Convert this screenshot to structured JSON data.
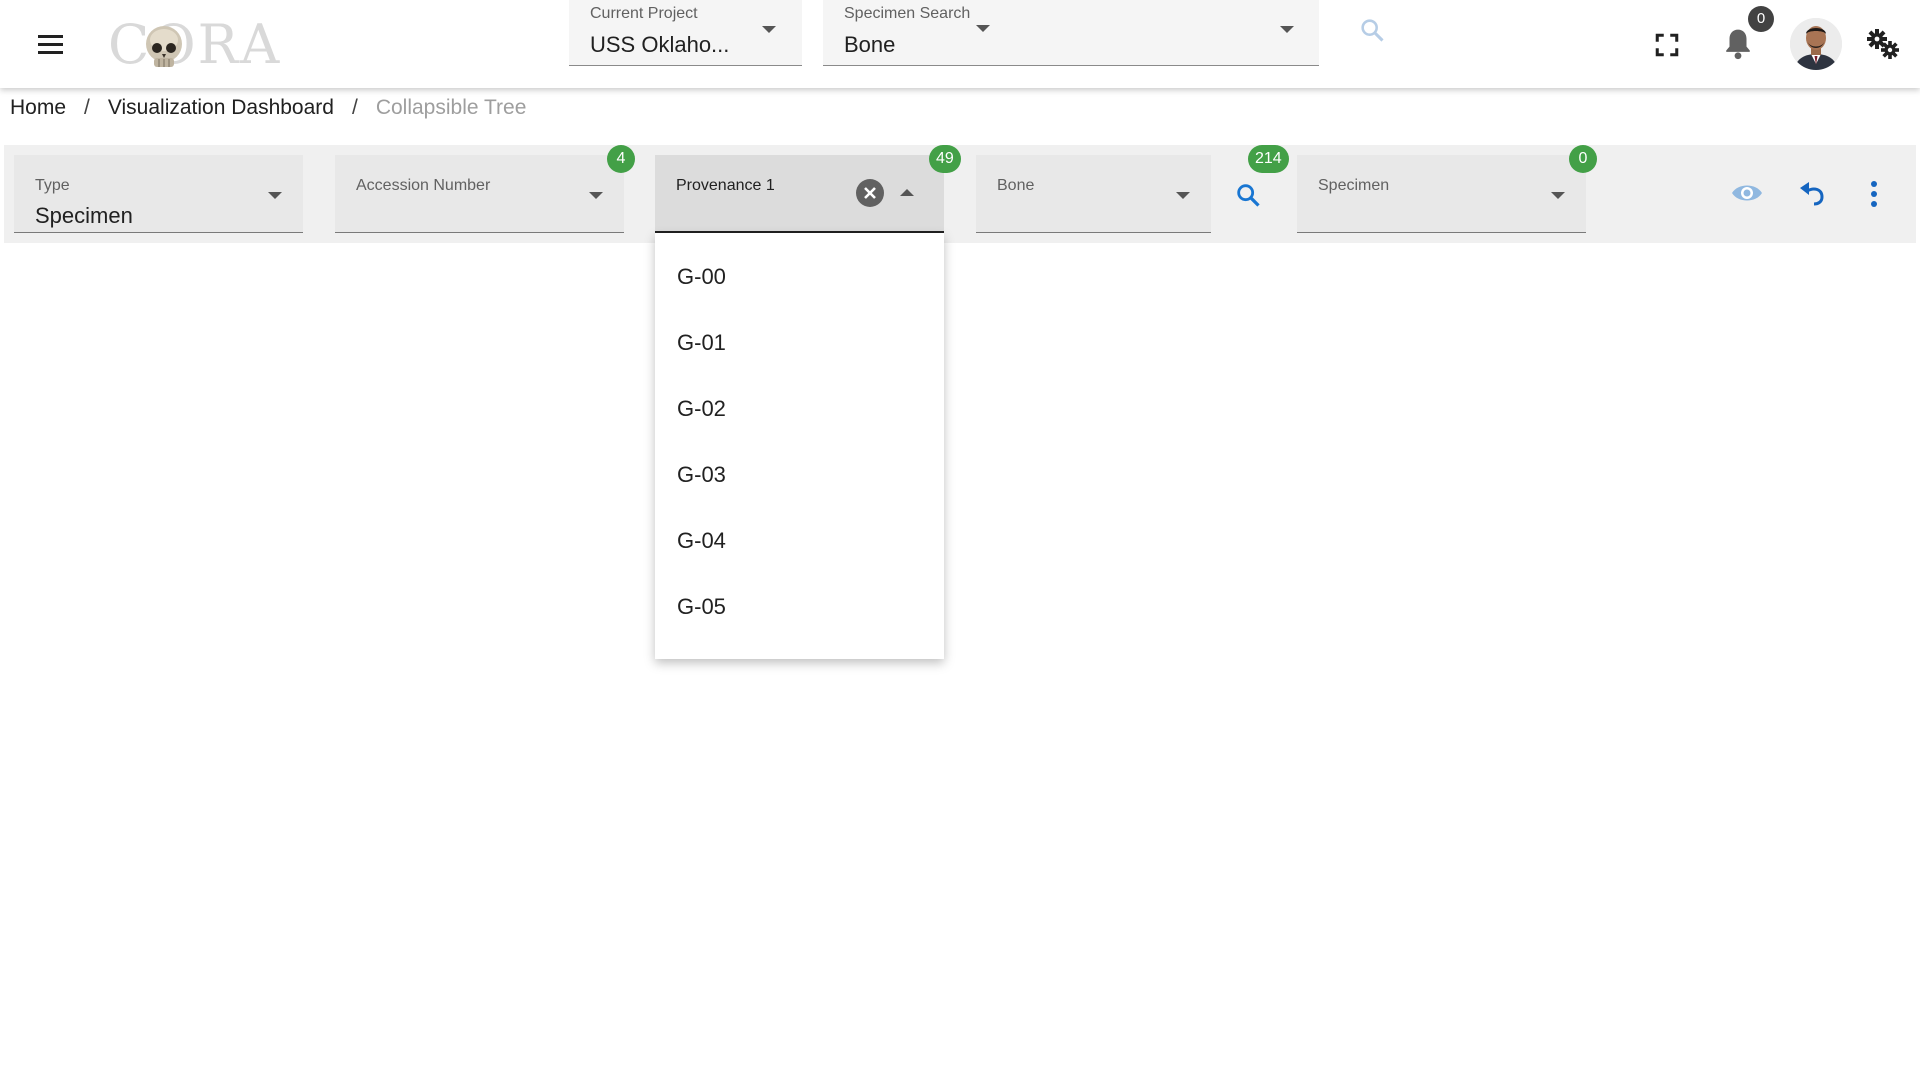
{
  "app": {
    "logo_text": "CORA"
  },
  "header": {
    "project": {
      "label": "Current Project",
      "value": "USS Oklaho..."
    },
    "specimen_search": {
      "label": "Specimen Search",
      "value": "Bone"
    },
    "notification_count": "0"
  },
  "breadcrumb": {
    "items": [
      "Home",
      "Visualization Dashboard"
    ],
    "separator": "/",
    "current": "Collapsible Tree"
  },
  "filters": {
    "type": {
      "label": "Type",
      "value": "Specimen"
    },
    "accession": {
      "label": "Accession Number",
      "value": "",
      "count": "4"
    },
    "provenance": {
      "label": "Provenance 1",
      "value": "",
      "count": "49"
    },
    "bone": {
      "label": "Bone",
      "value": "",
      "count": "214"
    },
    "specimen": {
      "label": "Specimen",
      "value": "",
      "count": "0"
    }
  },
  "dropdown": {
    "options": [
      "G-00",
      "G-01",
      "G-02",
      "G-03",
      "G-04",
      "G-05"
    ]
  },
  "colors": {
    "badge_green": "#43a047",
    "action_blue": "#1976d2",
    "eye_blue": "#90b8e0"
  }
}
